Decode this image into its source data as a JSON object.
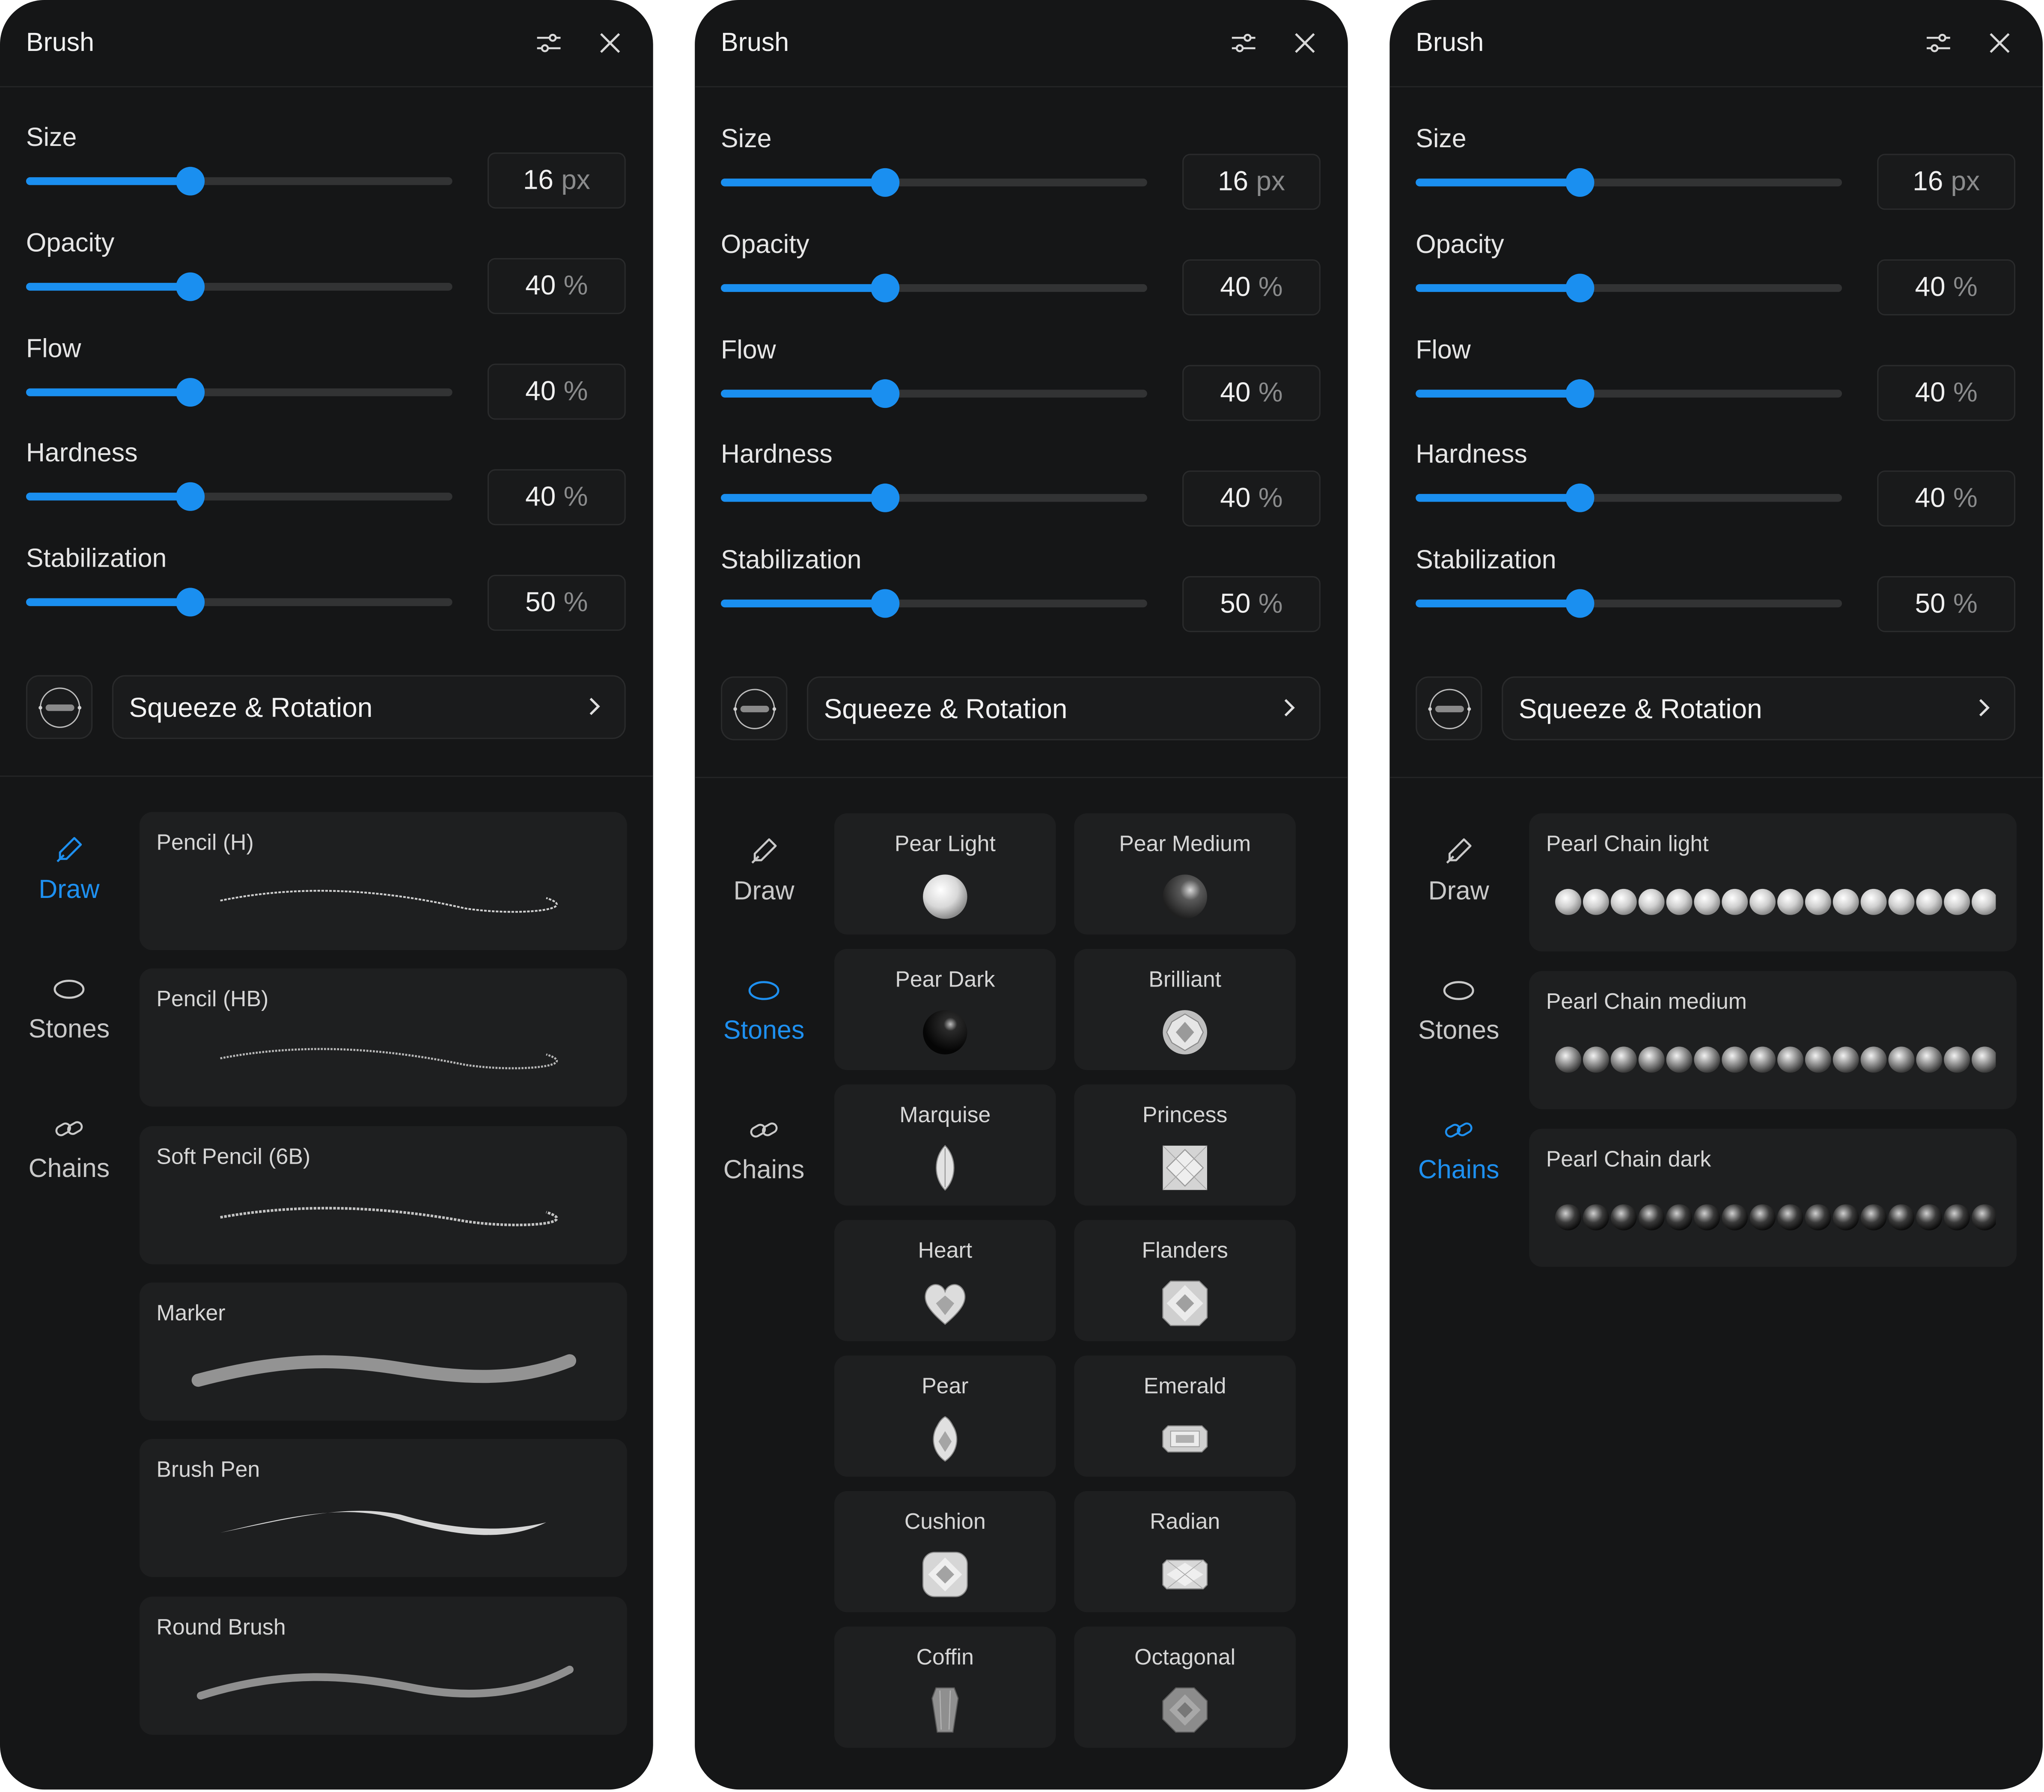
{
  "colors": {
    "accent": "#1a8ff0",
    "panel_bg": "#151617",
    "card_bg": "#1e1f20",
    "page_bg": "#ffffff"
  },
  "icons": {
    "settings": "sliders-icon",
    "close": "close-icon",
    "draw": "pencil-icon",
    "stones": "oval-icon",
    "chains": "link-icon",
    "squeeze": "brush-tip-icon",
    "chevron": "chevron-right-icon"
  },
  "panel_left": {
    "title": "Brush",
    "sliders": [
      {
        "label": "Size",
        "value": "16",
        "unit": "px",
        "fraction": 0.385
      },
      {
        "label": "Opacity",
        "value": "40",
        "unit": "%",
        "fraction": 0.385
      },
      {
        "label": "Flow",
        "value": "40",
        "unit": "%",
        "fraction": 0.385
      },
      {
        "label": "Hardness",
        "value": "40",
        "unit": "%",
        "fraction": 0.385
      },
      {
        "label": "Stabilization",
        "value": "50",
        "unit": "%",
        "fraction": 0.385
      }
    ],
    "squeeze_label": "Squeeze & Rotation",
    "nav": [
      {
        "label": "Draw",
        "active": true
      },
      {
        "label": "Stones",
        "active": false
      },
      {
        "label": "Chains",
        "active": false
      }
    ],
    "brushes": [
      {
        "name": "Pencil (H)"
      },
      {
        "name": "Pencil (HB)"
      },
      {
        "name": "Soft Pencil (6B)"
      },
      {
        "name": "Marker"
      },
      {
        "name": "Brush Pen"
      },
      {
        "name": "Round Brush"
      }
    ]
  },
  "panel_middle": {
    "title": "Brush",
    "sliders": [
      {
        "label": "Size",
        "value": "16",
        "unit": "px",
        "fraction": 0.385
      },
      {
        "label": "Opacity",
        "value": "40",
        "unit": "%",
        "fraction": 0.385
      },
      {
        "label": "Flow",
        "value": "40",
        "unit": "%",
        "fraction": 0.385
      },
      {
        "label": "Hardness",
        "value": "40",
        "unit": "%",
        "fraction": 0.385
      },
      {
        "label": "Stabilization",
        "value": "50",
        "unit": "%",
        "fraction": 0.385
      }
    ],
    "squeeze_label": "Squeeze & Rotation",
    "nav": [
      {
        "label": "Draw",
        "active": false
      },
      {
        "label": "Stones",
        "active": true
      },
      {
        "label": "Chains",
        "active": false
      }
    ],
    "stones": [
      {
        "name": "Pear Light"
      },
      {
        "name": "Pear Medium"
      },
      {
        "name": "Pear Dark"
      },
      {
        "name": "Brilliant"
      },
      {
        "name": "Marquise"
      },
      {
        "name": "Princess"
      },
      {
        "name": "Heart"
      },
      {
        "name": "Flanders"
      },
      {
        "name": "Pear"
      },
      {
        "name": "Emerald"
      },
      {
        "name": "Cushion"
      },
      {
        "name": "Radian"
      },
      {
        "name": "Coffin"
      },
      {
        "name": "Octagonal"
      }
    ]
  },
  "panel_right": {
    "title": "Brush",
    "sliders": [
      {
        "label": "Size",
        "value": "16",
        "unit": "px",
        "fraction": 0.385
      },
      {
        "label": "Opacity",
        "value": "40",
        "unit": "%",
        "fraction": 0.385
      },
      {
        "label": "Flow",
        "value": "40",
        "unit": "%",
        "fraction": 0.385
      },
      {
        "label": "Hardness",
        "value": "40",
        "unit": "%",
        "fraction": 0.385
      },
      {
        "label": "Stabilization",
        "value": "50",
        "unit": "%",
        "fraction": 0.385
      }
    ],
    "squeeze_label": "Squeeze & Rotation",
    "nav": [
      {
        "label": "Draw",
        "active": false
      },
      {
        "label": "Stones",
        "active": false
      },
      {
        "label": "Chains",
        "active": true
      }
    ],
    "chains": [
      {
        "name": "Pearl Chain light"
      },
      {
        "name": "Pearl Chain medium"
      },
      {
        "name": "Pearl Chain dark"
      }
    ]
  }
}
